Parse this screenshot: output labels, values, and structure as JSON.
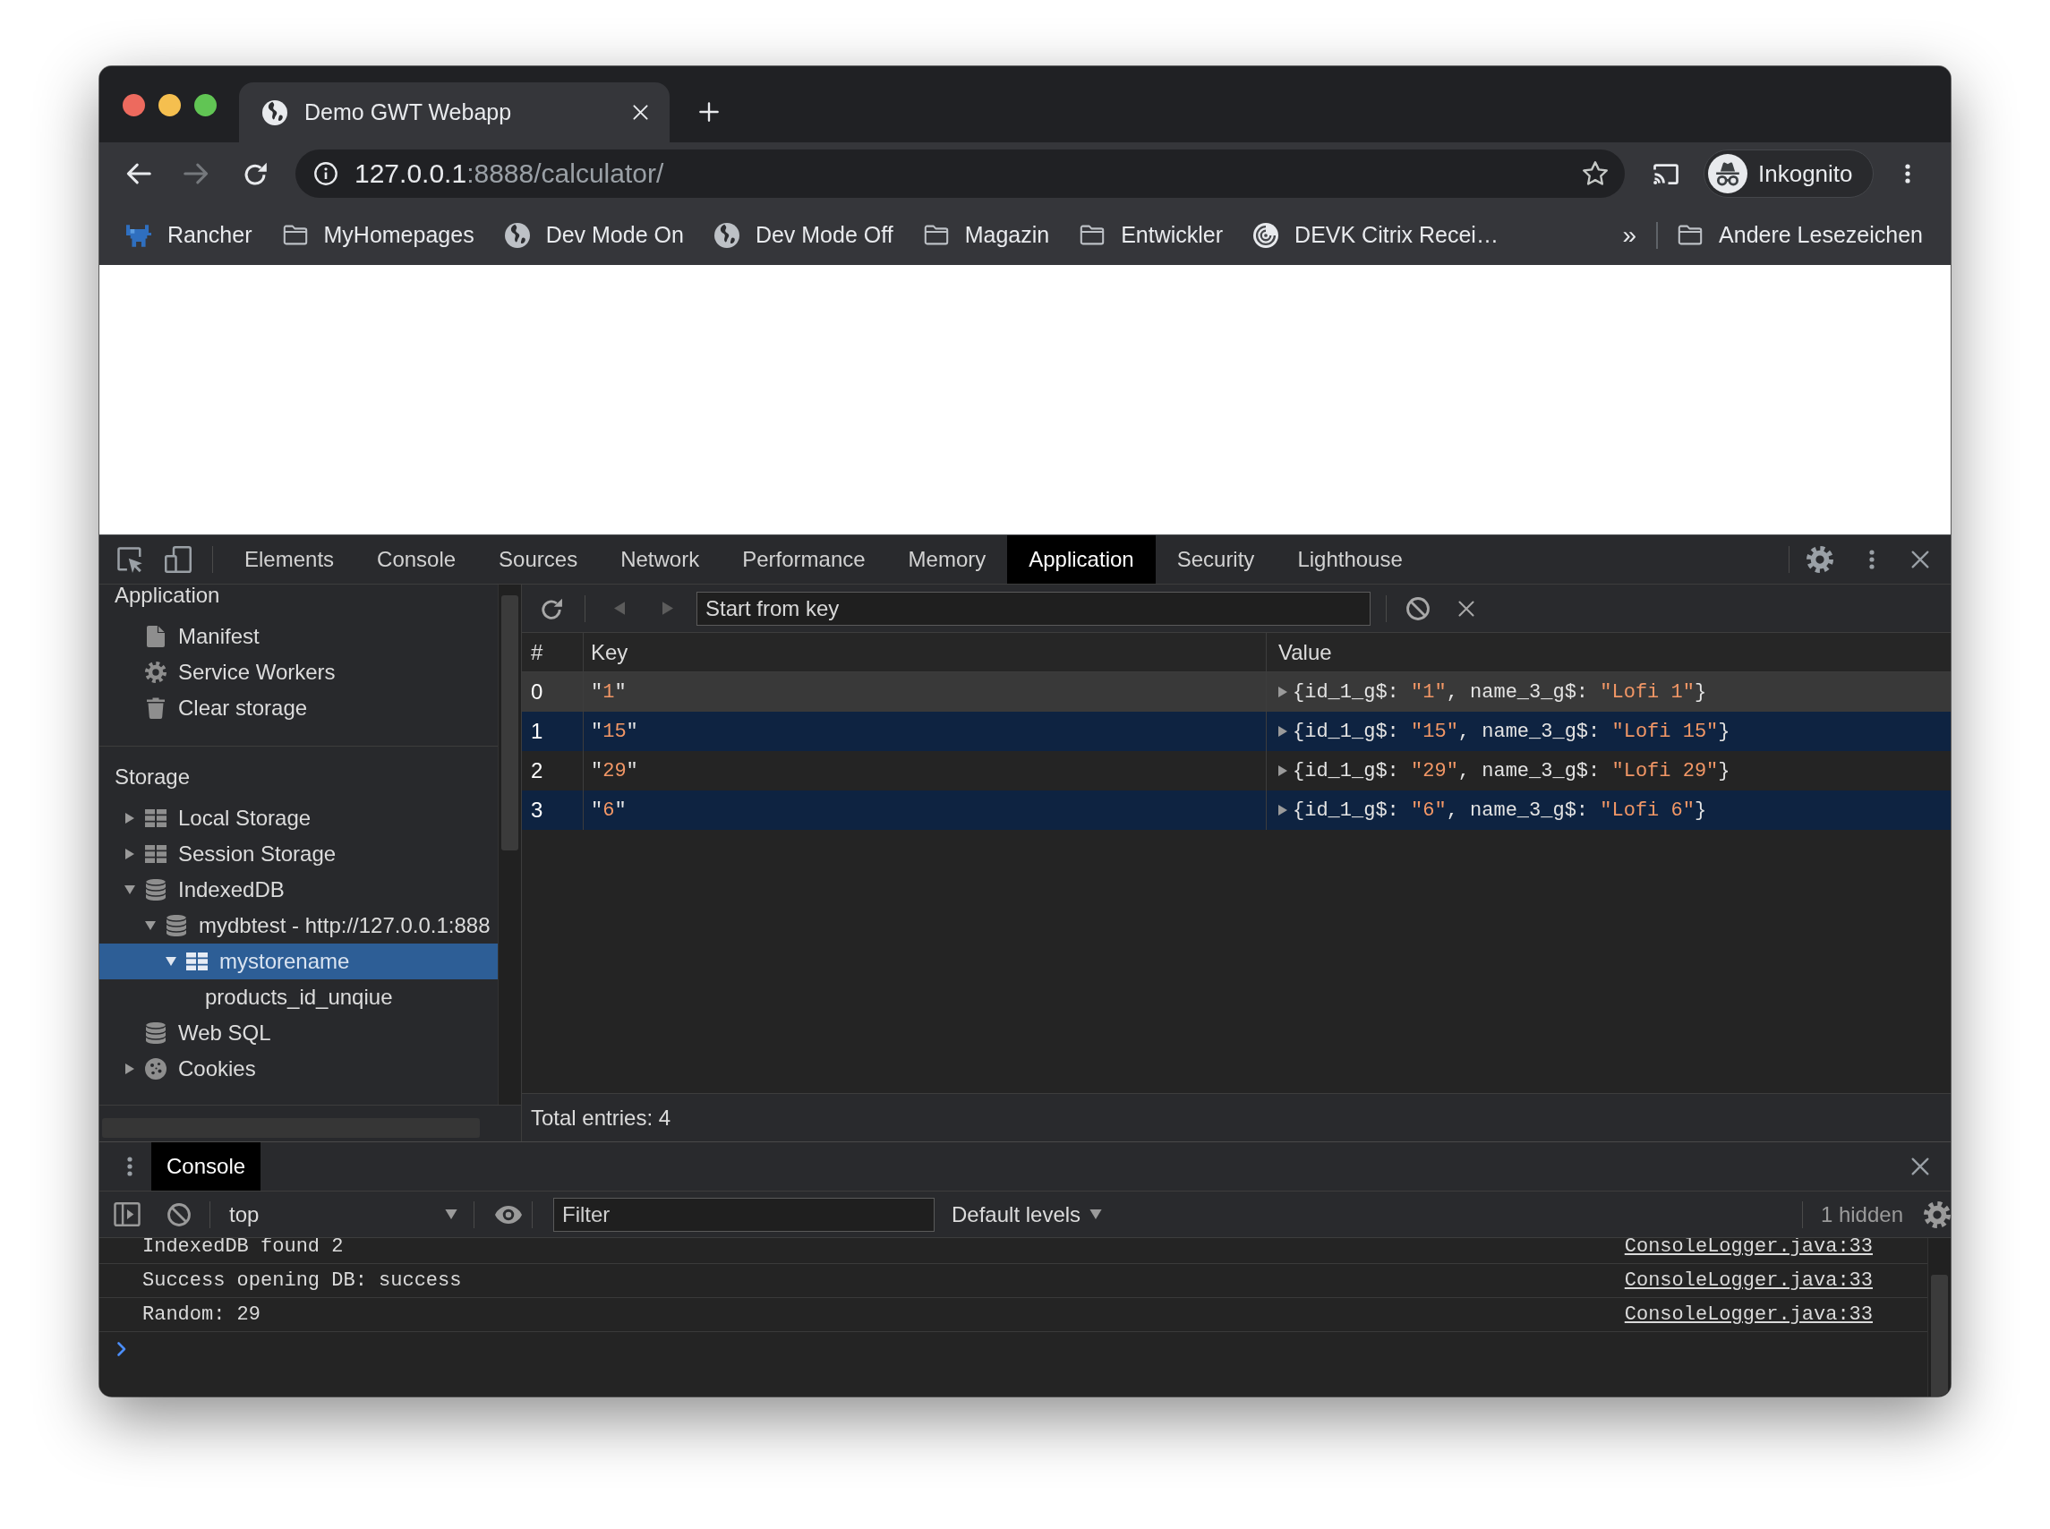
{
  "browser": {
    "tabs": [
      {
        "title": "Demo GWT Webapp",
        "selected": true
      }
    ],
    "nav_buttons": [
      {
        "kind": "back",
        "disabled": false
      },
      {
        "kind": "forward",
        "disabled": true
      }
    ],
    "address_bar": {
      "host": "127.0.0.1",
      "path": ":8888/calculator/"
    },
    "profile": {
      "label": "Inkognito"
    },
    "bookmarks": [
      {
        "label": "Rancher",
        "kind": "app"
      },
      {
        "label": "MyHomepages",
        "kind": "folder"
      },
      {
        "label": "Dev Mode On",
        "kind": "site"
      },
      {
        "label": "Dev Mode Off",
        "kind": "site"
      },
      {
        "label": "Magazin",
        "kind": "folder"
      },
      {
        "label": "Entwickler",
        "kind": "folder"
      },
      {
        "label": "DEVK Citrix Recei…",
        "kind": "citrix"
      }
    ],
    "bookmarks_overflow": "»",
    "other_bookmarks": {
      "label": "Andere Lesezeichen"
    }
  },
  "devtools": {
    "tabs": [
      {
        "label": "Elements",
        "selected": false
      },
      {
        "label": "Console",
        "selected": false
      },
      {
        "label": "Sources",
        "selected": false
      },
      {
        "label": "Network",
        "selected": false
      },
      {
        "label": "Performance",
        "selected": false
      },
      {
        "label": "Memory",
        "selected": false
      },
      {
        "label": "Application",
        "selected": true
      },
      {
        "label": "Security",
        "selected": false
      },
      {
        "label": "Lighthouse",
        "selected": false
      }
    ],
    "sidebar": {
      "sections": [
        {
          "title": "Application",
          "items": [
            {
              "label": "Manifest",
              "kind": "manifest",
              "selected": false
            },
            {
              "label": "Service Workers",
              "kind": "worker",
              "selected": false
            },
            {
              "label": "Clear storage",
              "kind": "trash",
              "selected": false
            }
          ]
        },
        {
          "title": "Storage",
          "items": [
            {
              "label": "Local Storage",
              "kind": "table",
              "expanded": false,
              "selected": false
            },
            {
              "label": "Session Storage",
              "kind": "table",
              "expanded": false,
              "selected": false
            },
            {
              "label": "IndexedDB",
              "kind": "database",
              "expanded": true,
              "selected": false,
              "children": [
                {
                  "label": "mydbtest - http://127.0.0.1:888",
                  "kind": "database",
                  "expanded": true,
                  "selected": false,
                  "children": [
                    {
                      "label": "mystorename",
                      "kind": "table",
                      "expanded": true,
                      "selected": true,
                      "children": [
                        {
                          "label": "products_id_unqiue",
                          "selected": false
                        }
                      ]
                    }
                  ]
                }
              ]
            },
            {
              "label": "Web SQL",
              "kind": "database",
              "selected": false
            },
            {
              "label": "Cookies",
              "kind": "cookie",
              "expanded": false,
              "selected": false
            }
          ]
        }
      ]
    },
    "indexeddb": {
      "page_buttons": [
        {
          "kind": "previous",
          "disabled": true
        },
        {
          "kind": "next",
          "disabled": true
        }
      ],
      "start_key": {
        "placeholder": "Start from key"
      },
      "table": {
        "columns": [
          "#",
          "Key",
          "Value"
        ],
        "rows": [
          {
            "index": "0",
            "key": [
              {
                "kind": "plain",
                "text": "\""
              },
              {
                "kind": "string",
                "text": "1"
              },
              {
                "kind": "plain",
                "text": "\""
              }
            ],
            "value": [
              {
                "kind": "plain",
                "text": "{id_1_g$: "
              },
              {
                "kind": "string",
                "text": "\"1\""
              },
              {
                "kind": "plain",
                "text": ", name_3_g$: "
              },
              {
                "kind": "string",
                "text": "\"Lofi 1\""
              },
              {
                "kind": "plain",
                "text": "}"
              }
            ],
            "expanded": false,
            "selected": true
          },
          {
            "index": "1",
            "key": [
              {
                "kind": "plain",
                "text": "\""
              },
              {
                "kind": "string",
                "text": "15"
              },
              {
                "kind": "plain",
                "text": "\""
              }
            ],
            "value": [
              {
                "kind": "plain",
                "text": "{id_1_g$: "
              },
              {
                "kind": "string",
                "text": "\"15\""
              },
              {
                "kind": "plain",
                "text": ", name_3_g$: "
              },
              {
                "kind": "string",
                "text": "\"Lofi 15\""
              },
              {
                "kind": "plain",
                "text": "}"
              }
            ],
            "expanded": false,
            "selected": false
          },
          {
            "index": "2",
            "key": [
              {
                "kind": "plain",
                "text": "\""
              },
              {
                "kind": "string",
                "text": "29"
              },
              {
                "kind": "plain",
                "text": "\""
              }
            ],
            "value": [
              {
                "kind": "plain",
                "text": "{id_1_g$: "
              },
              {
                "kind": "string",
                "text": "\"29\""
              },
              {
                "kind": "plain",
                "text": ", name_3_g$: "
              },
              {
                "kind": "string",
                "text": "\"Lofi 29\""
              },
              {
                "kind": "plain",
                "text": "}"
              }
            ],
            "expanded": false,
            "selected": false
          },
          {
            "index": "3",
            "key": [
              {
                "kind": "plain",
                "text": "\""
              },
              {
                "kind": "string",
                "text": "6"
              },
              {
                "kind": "plain",
                "text": "\""
              }
            ],
            "value": [
              {
                "kind": "plain",
                "text": "{id_1_g$: "
              },
              {
                "kind": "string",
                "text": "\"6\""
              },
              {
                "kind": "plain",
                "text": ", name_3_g$: "
              },
              {
                "kind": "string",
                "text": "\"Lofi 6\""
              },
              {
                "kind": "plain",
                "text": "}"
              }
            ],
            "expanded": false,
            "selected": false
          }
        ]
      },
      "footer": "Total entries: 4"
    }
  },
  "drawer": {
    "tabs": [
      {
        "label": "Console",
        "selected": true
      }
    ],
    "context": "top",
    "filter": {
      "placeholder": "Filter"
    },
    "levels": "Default levels",
    "hidden_count": "1 hidden",
    "messages": [
      {
        "text": "IndexedDB found 2",
        "source": "ConsoleLogger.java:33"
      },
      {
        "text": "Success opening DB: success",
        "source": "ConsoleLogger.java:33"
      },
      {
        "text": "Random: 29",
        "source": "ConsoleLogger.java:33"
      }
    ]
  }
}
